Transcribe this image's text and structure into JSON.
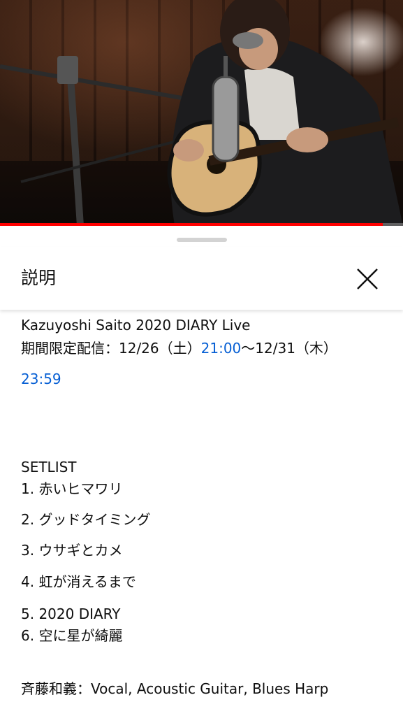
{
  "video": {
    "player": "video-player",
    "progress_percent": 95
  },
  "sheet": {
    "title": "説明",
    "close_icon": "close-icon"
  },
  "description": {
    "line1": "Kazuyoshi Saito 2020 DIARY Live",
    "line2_prefix": "期間限定配信：12/26（土）",
    "line2_link": "21:00",
    "line2_suffix": "〜12/31（木）",
    "line3_link": "23:59",
    "setlist_heading": "SETLIST",
    "setlist": [
      "1. 赤いヒマワリ",
      "2. グッドタイミング",
      "3. ウサギとカメ",
      "4. 虹が消えるまで",
      "5. 2020 DIARY",
      "6. 空に星が綺麗"
    ],
    "credit": "斉藤和義：Vocal, Acoustic Guitar, Blues Harp"
  },
  "colors": {
    "link": "#065fd4",
    "progress": "#ff0000",
    "text": "#0f0f0f"
  }
}
